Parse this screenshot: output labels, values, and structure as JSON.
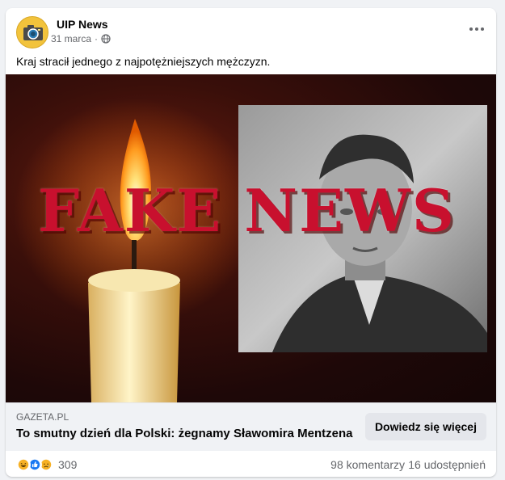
{
  "post": {
    "page_name": "UIP News",
    "date": "31 marca",
    "separator": "·",
    "text": "Kraj stracił jednego z najpotężniejszych mężczyzn.",
    "overlay_text": "FAKE NEWS"
  },
  "link": {
    "domain": "GAZETA.PL",
    "title": "To smutny dzień dla Polski: żegnamy Sławomira Mentzena",
    "cta_label": "Dowiedz się więcej"
  },
  "stats": {
    "reactions_count": "309",
    "reaction_icons": [
      "haha-icon",
      "like-icon",
      "sad-icon"
    ],
    "comments": "98 komentarzy",
    "shares": "16 udostępnień"
  },
  "colors": {
    "overlay_red": "#c8102e",
    "link_box_bg": "#f0f2f5",
    "secondary_text": "#65676b"
  }
}
